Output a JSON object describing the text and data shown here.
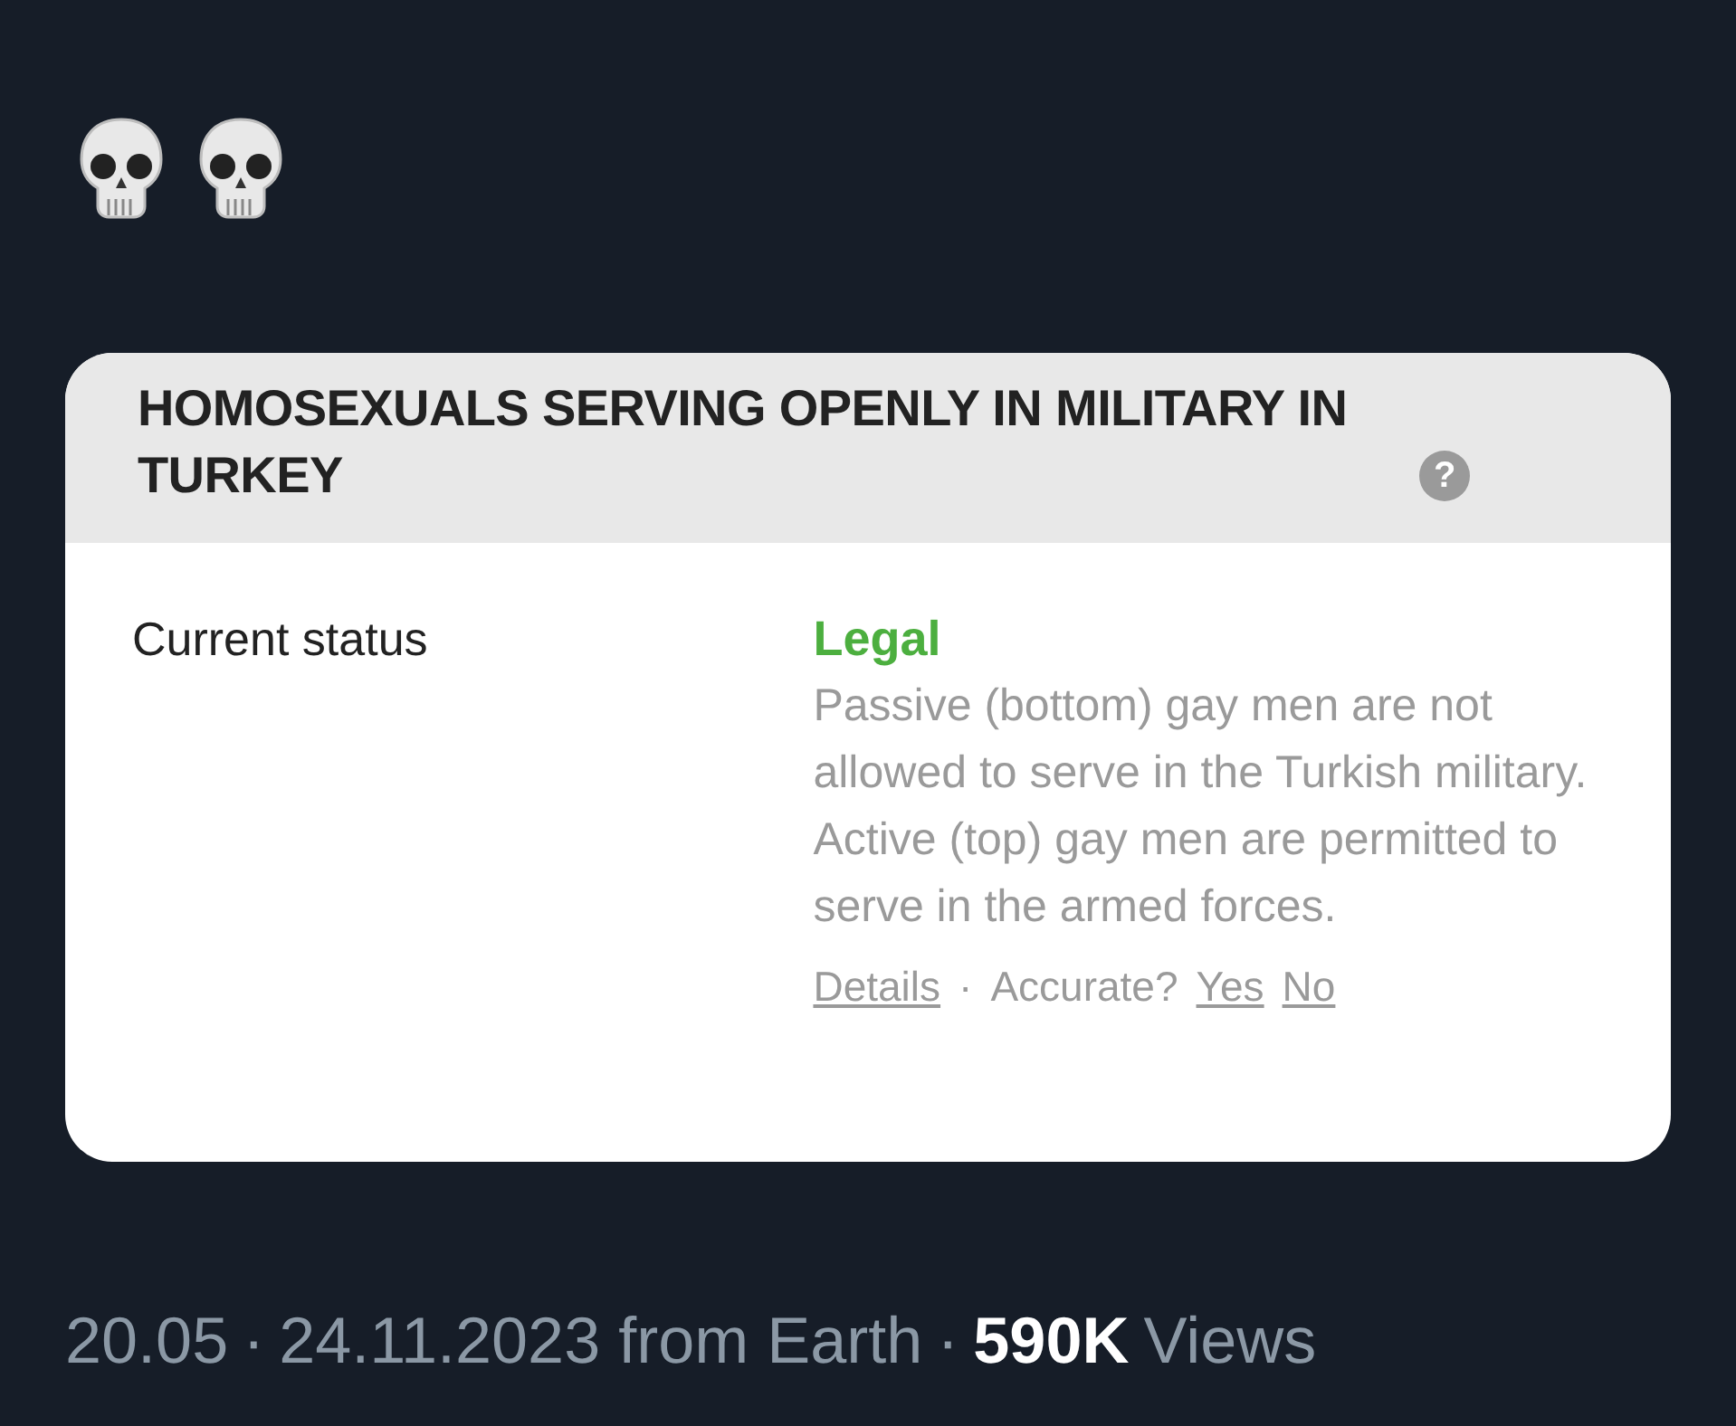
{
  "post_icons": [
    {
      "kind": "skull"
    },
    {
      "kind": "skull"
    }
  ],
  "card": {
    "title": "HOMOSEXUALS SERVING OPENLY IN MILITARY IN TURKEY",
    "help": "?",
    "row_label": "Current status",
    "status": "Legal",
    "description": "Passive (bottom) gay men are not allowed to serve in the Turkish military. Active (top) gay men are permitted to serve in the armed forces.",
    "details_link": "Details",
    "separator": "·",
    "question": "Accurate?",
    "answers": [
      "Yes",
      "No"
    ]
  },
  "meta": {
    "time": "20.05",
    "sep1": "·",
    "date": "24.11.2023 from Earth",
    "sep2": "·",
    "views_count": "590K",
    "views_label": "Views"
  }
}
